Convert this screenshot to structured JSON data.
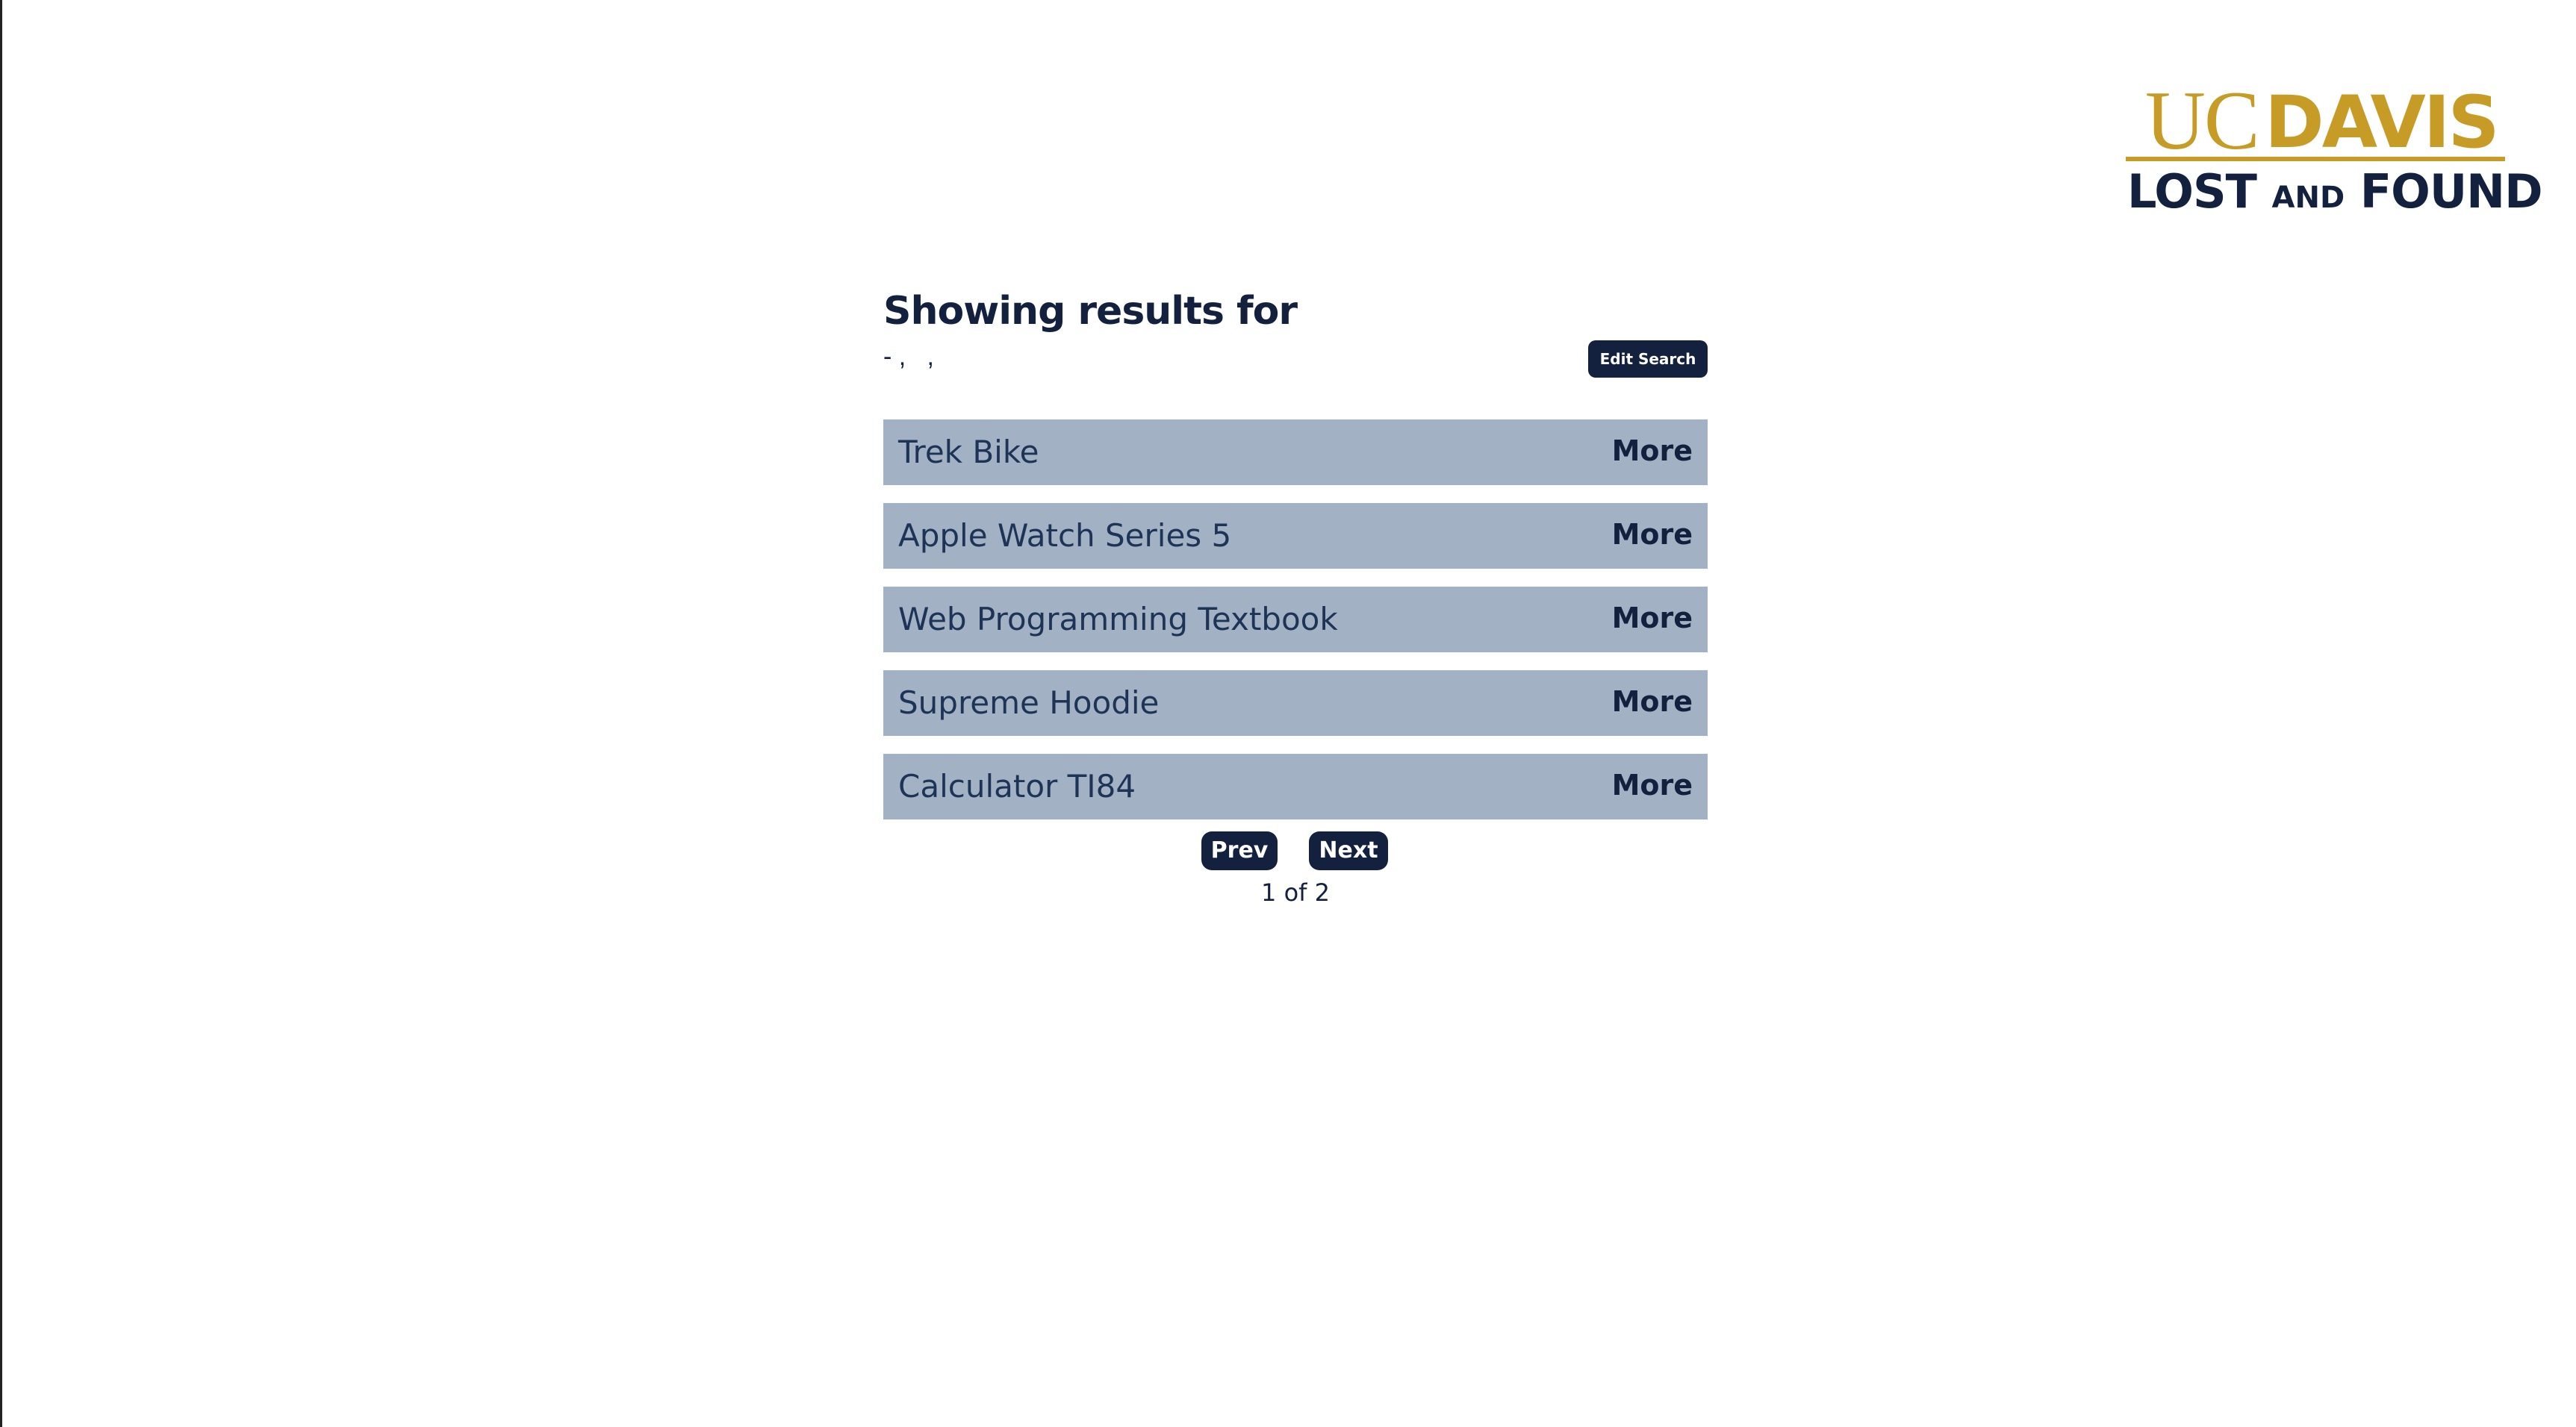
{
  "logo": {
    "uc": "UC",
    "davis": "DAVIS",
    "lost": "LOST ",
    "and": "AND",
    "found": " FOUND"
  },
  "search": {
    "heading": "Showing results for",
    "query": "- ,   ,",
    "edit_label": "Edit Search"
  },
  "results": [
    {
      "title": "Trek Bike",
      "more_label": "More"
    },
    {
      "title": "Apple Watch Series 5",
      "more_label": "More"
    },
    {
      "title": "Web Programming Textbook",
      "more_label": "More"
    },
    {
      "title": "Supreme Hoodie",
      "more_label": "More"
    },
    {
      "title": "Calculator TI84",
      "more_label": "More"
    }
  ],
  "pagination": {
    "prev_label": "Prev",
    "next_label": "Next",
    "status": "1 of 2"
  },
  "colors": {
    "navy": "#13213f",
    "gold": "#c69b26",
    "row_background": "#a3b1c5"
  }
}
